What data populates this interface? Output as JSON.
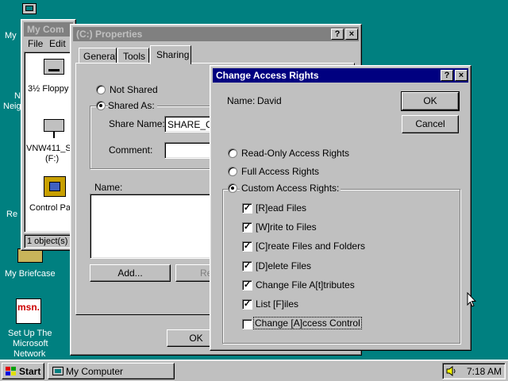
{
  "desktop": {
    "labels": [
      "My",
      "N",
      "Neig",
      "Re",
      "My Briefcase",
      "Set Up The",
      "Microsoft",
      "Network"
    ],
    "msn_badge": "msn."
  },
  "my_computer": {
    "title": "My Com",
    "menu": [
      "File",
      "Edit"
    ],
    "items": [
      "3½ Floppy (",
      "VNW411_S",
      "(F:)",
      "Control Par"
    ],
    "status": "1 object(s) s"
  },
  "properties": {
    "title": "(C:) Properties",
    "tabs": [
      "General",
      "Tools",
      "Sharing"
    ],
    "active_tab": "Sharing",
    "not_shared": "Not Shared",
    "shared_as": "Shared As:",
    "share_name_label": "Share Name:",
    "share_name_value": "SHARE_C",
    "comment_label": "Comment:",
    "name_label": "Name:",
    "add_button": "Add...",
    "remove_button_partial": "Re",
    "ok_button": "OK"
  },
  "dialog": {
    "title": "Change Access Rights",
    "name_label": "Name:",
    "name_value": "David",
    "ok_button": "OK",
    "cancel_button": "Cancel",
    "options": {
      "readonly": "Read-Only Access Rights",
      "full": "Full Access Rights",
      "custom": "Custom Access Rights:"
    },
    "selected_option": "custom",
    "rights": [
      {
        "label": "[R]ead Files",
        "checked": true
      },
      {
        "label": "[W]rite to Files",
        "checked": true
      },
      {
        "label": "[C]reate Files and Folders",
        "checked": true
      },
      {
        "label": "[D]elete Files",
        "checked": true
      },
      {
        "label": "Change File A[t]tributes",
        "checked": true
      },
      {
        "label": "List [F]iles",
        "checked": true
      },
      {
        "label": "Change [A]ccess Control",
        "checked": false
      }
    ]
  },
  "taskbar": {
    "start": "Start",
    "task": "My Computer",
    "clock": "7:18 AM"
  },
  "colors": {
    "desktop": "#008080",
    "active_title": "#000080",
    "inactive_title": "#808080",
    "face": "#c0c0c0"
  }
}
